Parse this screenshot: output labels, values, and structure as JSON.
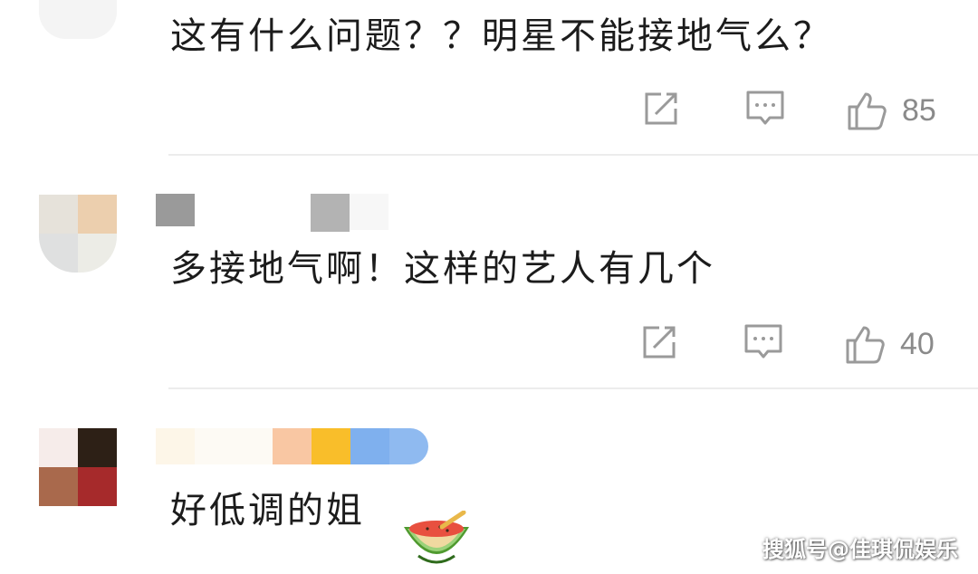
{
  "comments": [
    {
      "text": "这有什么问题？？明星不能接地气么？",
      "likes": "85",
      "avatar_colors": [
        "#eeeeee",
        "#111111",
        "#f5f5f5",
        "#f5f5f5"
      ]
    },
    {
      "text": "多接地气啊！这样的艺人有几个",
      "likes": "40",
      "avatar_colors": [
        "#e6e2da",
        "#eccfae",
        "#dfe0e0",
        "#ecece6"
      ]
    },
    {
      "text": "好低调的姐",
      "avatar_colors": [
        "#f6ecea",
        "#2d2016",
        "#a9694c",
        "#a62a2b"
      ]
    }
  ],
  "icons": {
    "share": "share-icon",
    "reply": "comment-icon",
    "like": "thumbs-up-icon",
    "emoji": "watermelon-emoji-icon"
  },
  "watermark": "搜狐号@佳琪侃娱乐",
  "colors": {
    "icon": "#9a9a9a",
    "text": "#1c1c1c",
    "count": "#8a8a8a",
    "divider": "#ececec"
  }
}
